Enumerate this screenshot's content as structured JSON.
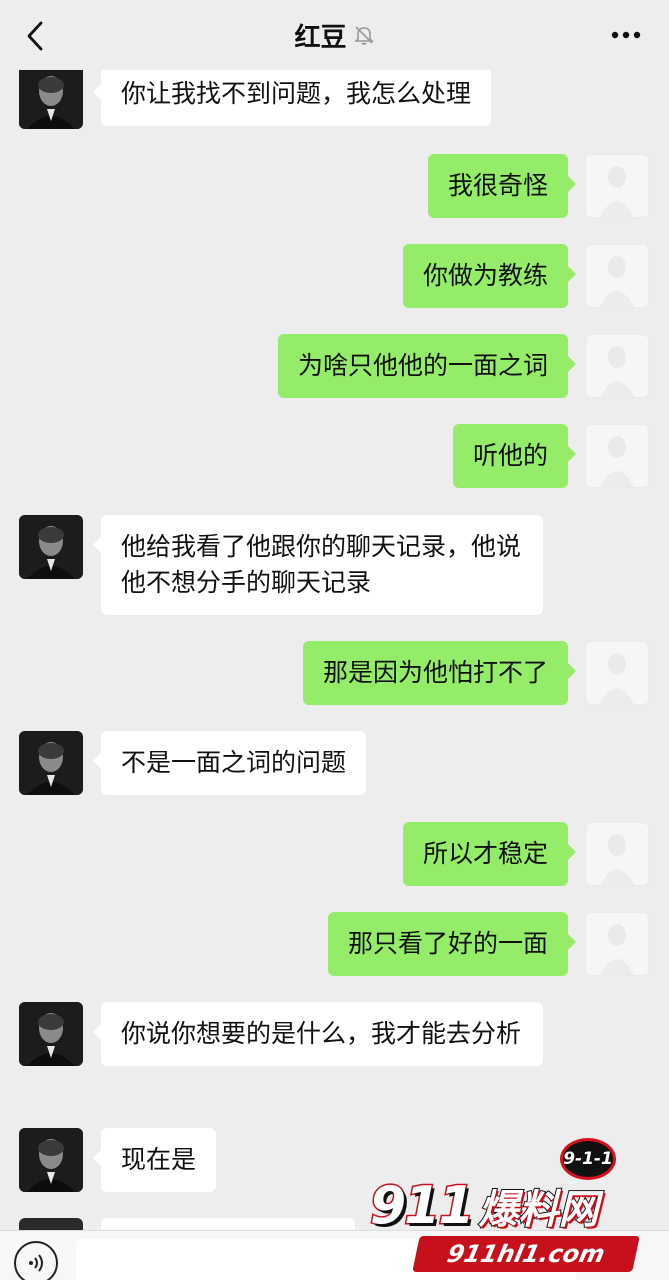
{
  "header": {
    "back_icon": "chevron-left-icon",
    "title": "红豆",
    "mute_icon": "bell-muted-icon",
    "more_icon": "more-dots-icon"
  },
  "messages": [
    {
      "from": "other",
      "text": "你让我找不到问题，我怎么处理"
    },
    {
      "from": "me",
      "text": "我很奇怪"
    },
    {
      "from": "me",
      "text": "你做为教练"
    },
    {
      "from": "me",
      "text": "为啥只他他的一面之词"
    },
    {
      "from": "me",
      "text": "听他的"
    },
    {
      "from": "other",
      "text": "他给我看了他跟你的聊天记录，他说他不想分手的聊天记录"
    },
    {
      "from": "me",
      "text": "那是因为他怕打不了"
    },
    {
      "from": "other",
      "text": "不是一面之词的问题"
    },
    {
      "from": "me",
      "text": "所以才稳定"
    },
    {
      "from": "me",
      "text": "那只看了好的一面"
    },
    {
      "from": "other",
      "text": "你说你想要的是什么，我才能去分析"
    },
    {
      "from": "other",
      "text": "现在是"
    }
  ],
  "input_bar": {
    "voice_icon": "voice-icon",
    "placeholder": ""
  },
  "watermark": {
    "badge": "9-1-1",
    "number": "911",
    "word": "爆料网",
    "url": "911hl1.com"
  },
  "colors": {
    "background": "#ededed",
    "bubble_me": "#95ec69",
    "bubble_other": "#ffffff",
    "watermark_red": "#c8101c"
  }
}
